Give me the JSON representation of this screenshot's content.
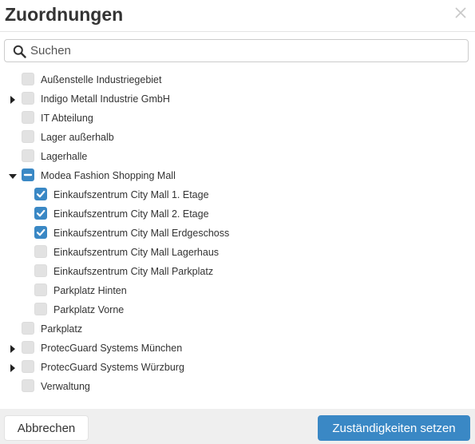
{
  "dialog": {
    "title": "Zuordnungen",
    "close_icon": "close-icon"
  },
  "search": {
    "placeholder": "Suchen",
    "value": "",
    "icon": "search-icon"
  },
  "tree": [
    {
      "label": "Außenstelle Industriegebiet",
      "level": 0,
      "expander": "none",
      "state": "unchecked"
    },
    {
      "label": "Indigo Metall Industrie GmbH",
      "level": 0,
      "expander": "collapsed",
      "state": "unchecked"
    },
    {
      "label": "IT Abteilung",
      "level": 0,
      "expander": "none",
      "state": "unchecked"
    },
    {
      "label": "Lager außerhalb",
      "level": 0,
      "expander": "none",
      "state": "unchecked"
    },
    {
      "label": "Lagerhalle",
      "level": 0,
      "expander": "none",
      "state": "unchecked"
    },
    {
      "label": "Modea Fashion Shopping Mall",
      "level": 0,
      "expander": "expanded",
      "state": "partial"
    },
    {
      "label": "Einkaufszentrum City Mall 1. Etage",
      "level": 1,
      "expander": "none",
      "state": "checked"
    },
    {
      "label": "Einkaufszentrum City Mall 2. Etage",
      "level": 1,
      "expander": "none",
      "state": "checked"
    },
    {
      "label": "Einkaufszentrum City Mall Erdgeschoss",
      "level": 1,
      "expander": "none",
      "state": "checked"
    },
    {
      "label": "Einkaufszentrum City Mall Lagerhaus",
      "level": 1,
      "expander": "none",
      "state": "unchecked"
    },
    {
      "label": "Einkaufszentrum City Mall Parkplatz",
      "level": 1,
      "expander": "none",
      "state": "unchecked"
    },
    {
      "label": "Parkplatz Hinten",
      "level": 1,
      "expander": "none",
      "state": "unchecked"
    },
    {
      "label": "Parkplatz Vorne",
      "level": 1,
      "expander": "none",
      "state": "unchecked"
    },
    {
      "label": "Parkplatz",
      "level": 0,
      "expander": "none",
      "state": "unchecked"
    },
    {
      "label": "ProtecGuard Systems München",
      "level": 0,
      "expander": "collapsed",
      "state": "unchecked"
    },
    {
      "label": "ProtecGuard Systems Würzburg",
      "level": 0,
      "expander": "collapsed",
      "state": "unchecked"
    },
    {
      "label": "Verwaltung",
      "level": 0,
      "expander": "none",
      "state": "unchecked"
    }
  ],
  "footer": {
    "cancel_label": "Abbrechen",
    "submit_label": "Zuständigkeiten setzen"
  },
  "colors": {
    "accent": "#3a88c5",
    "checkbox_unchecked": "#e2e2e2",
    "footer_bg": "#efefef"
  }
}
